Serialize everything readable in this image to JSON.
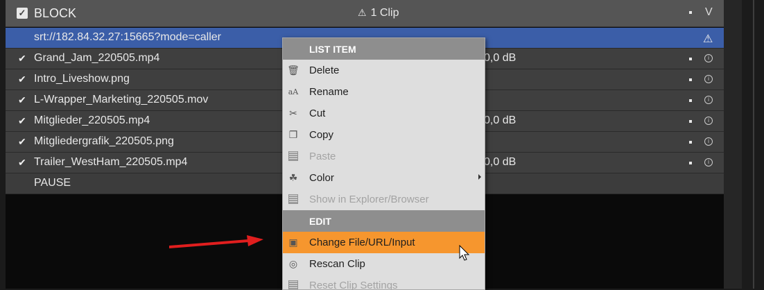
{
  "header": {
    "title": "BLOCK",
    "warning_text": "1 Clip",
    "checkbox_icon": "checkbox-checked-icon",
    "chevron_icon": "chevron-down-icon"
  },
  "rows": [
    {
      "name": "srt://182.84.32.27:15665?mode=caller",
      "db": "",
      "checked": false,
      "selected": true,
      "icon": "warning-icon"
    },
    {
      "name": "Grand_Jam_220505.mp4",
      "db": "0,0 dB",
      "checked": true,
      "selected": false,
      "icon": "info-icon"
    },
    {
      "name": "Intro_Liveshow.png",
      "db": "",
      "checked": true,
      "selected": false,
      "icon": "info-icon"
    },
    {
      "name": "L-Wrapper_Marketing_220505.mov",
      "db": "",
      "checked": true,
      "selected": false,
      "icon": "info-icon"
    },
    {
      "name": "Mitglieder_220505.mp4",
      "db": "0,0 dB",
      "checked": true,
      "selected": false,
      "icon": "info-icon"
    },
    {
      "name": "Mitgliedergrafik_220505.png",
      "db": "",
      "checked": true,
      "selected": false,
      "icon": "info-icon"
    },
    {
      "name": "Trailer_WestHam_220505.mp4",
      "db": "0,0 dB",
      "checked": true,
      "selected": false,
      "icon": "info-icon"
    },
    {
      "name": "PAUSE",
      "db": "",
      "checked": false,
      "selected": false,
      "icon": ""
    }
  ],
  "context_menu": {
    "section_list_item": "LIST ITEM",
    "section_edit": "EDIT",
    "items": [
      {
        "label": "Delete",
        "icon": "trash-icon",
        "disabled": false
      },
      {
        "label": "Rename",
        "icon": "rename-icon",
        "disabled": false
      },
      {
        "label": "Cut",
        "icon": "scissors-icon",
        "disabled": false
      },
      {
        "label": "Copy",
        "icon": "copy-icon",
        "disabled": false
      },
      {
        "label": "Paste",
        "icon": "paste-icon",
        "disabled": true
      },
      {
        "label": "Color",
        "icon": "color-icon",
        "disabled": false,
        "submenu": true
      },
      {
        "label": "Show in Explorer/Browser",
        "icon": "explorer-icon",
        "disabled": true
      },
      {
        "label": "Change File/URL/Input",
        "icon": "change-file-icon",
        "disabled": false,
        "highlighted": true
      },
      {
        "label": "Rescan Clip",
        "icon": "rescan-icon",
        "disabled": false
      },
      {
        "label": "Reset Clip Settings",
        "icon": "reset-icon",
        "disabled": true
      }
    ]
  },
  "colors": {
    "selected_row": "#3b5ea8",
    "highlight": "#f6962e",
    "arrow": "#e01e1e"
  }
}
